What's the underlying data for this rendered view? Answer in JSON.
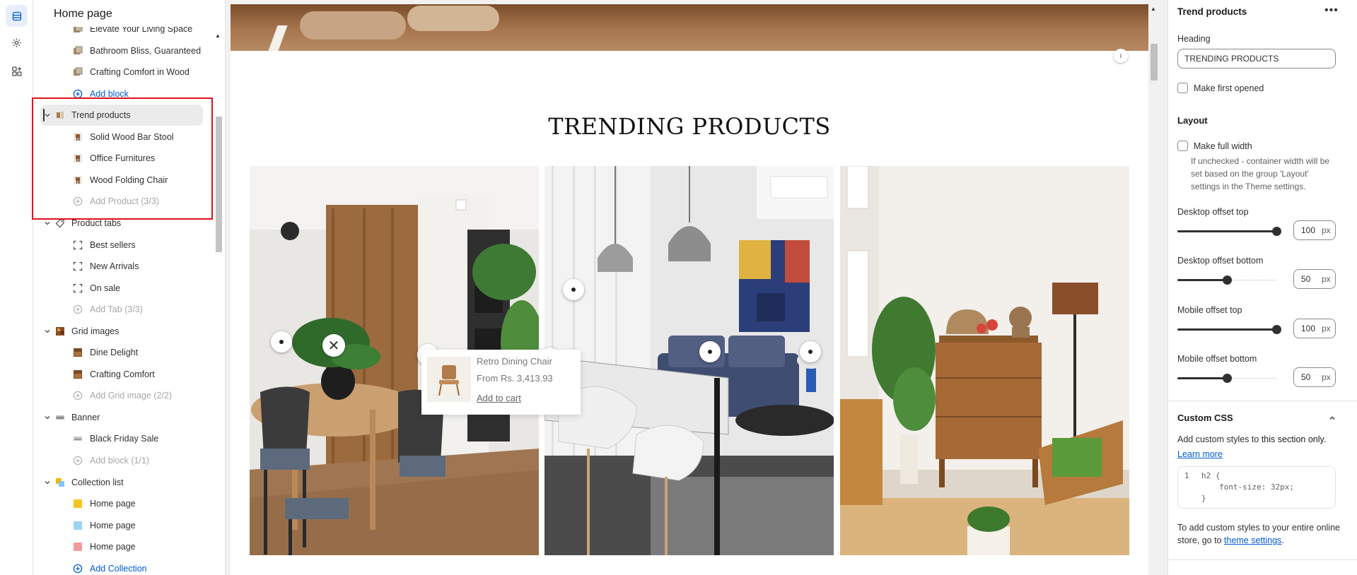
{
  "sidebar": {
    "title": "Home page",
    "rows": [
      {
        "label": "Elevate Your Living Space",
        "kind": "block",
        "icon": "image-icon"
      },
      {
        "label": "Bathroom Bliss, Guaranteed",
        "kind": "block",
        "icon": "image-icon"
      },
      {
        "label": "Crafting Comfort in Wood",
        "kind": "block",
        "icon": "image-icon"
      },
      {
        "label": "Add block",
        "kind": "add",
        "icon": "plus-circle-icon"
      },
      {
        "label": "Trend products",
        "kind": "section",
        "icon": "product-icon",
        "selected": true
      },
      {
        "label": "Solid Wood Bar Stool",
        "kind": "block",
        "icon": "product-thumb-icon"
      },
      {
        "label": "Office Furnitures",
        "kind": "block",
        "icon": "product-thumb-icon"
      },
      {
        "label": "Wood Folding Chair",
        "kind": "block",
        "icon": "product-thumb-icon"
      },
      {
        "label": "Add Product (3/3)",
        "kind": "add-disabled",
        "icon": "plus-circle-icon"
      },
      {
        "label": "Product tabs",
        "kind": "section",
        "icon": "tag-icon"
      },
      {
        "label": "Best sellers",
        "kind": "block",
        "icon": "frame-icon"
      },
      {
        "label": "New Arrivals",
        "kind": "block",
        "icon": "frame-icon"
      },
      {
        "label": "On sale",
        "kind": "block",
        "icon": "frame-icon"
      },
      {
        "label": "Add Tab (3/3)",
        "kind": "add-disabled",
        "icon": "plus-circle-icon"
      },
      {
        "label": "Grid images",
        "kind": "section",
        "icon": "grid-image-icon"
      },
      {
        "label": "Dine Delight",
        "kind": "block",
        "icon": "image-thumb-icon"
      },
      {
        "label": "Crafting Comfort",
        "kind": "block",
        "icon": "image-thumb-icon"
      },
      {
        "label": "Add Grid image (2/2)",
        "kind": "add-disabled",
        "icon": "plus-circle-icon"
      },
      {
        "label": "Banner",
        "kind": "section",
        "icon": "banner-icon"
      },
      {
        "label": "Black Friday Sale",
        "kind": "block",
        "icon": "banner-thumb-icon"
      },
      {
        "label": "Add block (1/1)",
        "kind": "add-disabled",
        "icon": "plus-circle-icon"
      },
      {
        "label": "Collection list",
        "kind": "section",
        "icon": "collection-icon"
      },
      {
        "label": "Home page",
        "kind": "block",
        "icon": "swatch-yellow-icon"
      },
      {
        "label": "Home page",
        "kind": "block",
        "icon": "swatch-blue-icon"
      },
      {
        "label": "Home page",
        "kind": "block",
        "icon": "swatch-red-icon"
      },
      {
        "label": "Add Collection",
        "kind": "add",
        "icon": "plus-circle-icon"
      }
    ]
  },
  "preview": {
    "heading": "TRENDING PRODUCTS",
    "popup": {
      "name": "Retro Dining Chair",
      "price": "From Rs. 3,413.93",
      "cart": "Add to cart"
    },
    "close_symbol": "✕"
  },
  "panel": {
    "title": "Trend products",
    "more": "•••",
    "heading_label": "Heading",
    "heading_value": "TRENDING PRODUCTS",
    "first_opened": "Make first opened",
    "layout_title": "Layout",
    "full_width": "Make full width",
    "full_width_help": "If unchecked - container width will be set based on the group 'Layout' settings in the Theme settings.",
    "sliders": [
      {
        "label": "Desktop offset top",
        "value": "100",
        "unit": "px",
        "fraction": 1.0
      },
      {
        "label": "Desktop offset bottom",
        "value": "50",
        "unit": "px",
        "fraction": 0.5
      },
      {
        "label": "Mobile offset top",
        "value": "100",
        "unit": "px",
        "fraction": 1.0
      },
      {
        "label": "Mobile offset bottom",
        "value": "50",
        "unit": "px",
        "fraction": 0.5
      }
    ],
    "css_title": "Custom CSS",
    "css_help_pre": "Add custom styles to ",
    "css_help_bold": "this section only.",
    "learn_more": "Learn more",
    "code_line_no": "1",
    "code_1": "h2 {",
    "code_2": "font-size: 32px;",
    "code_3": "}",
    "footer_pre": "To add custom styles to your entire online store, go to ",
    "footer_link": "theme settings",
    "footer_post": "."
  },
  "colors": {
    "accent": "#005bd3",
    "highlight": "#e0101c"
  }
}
